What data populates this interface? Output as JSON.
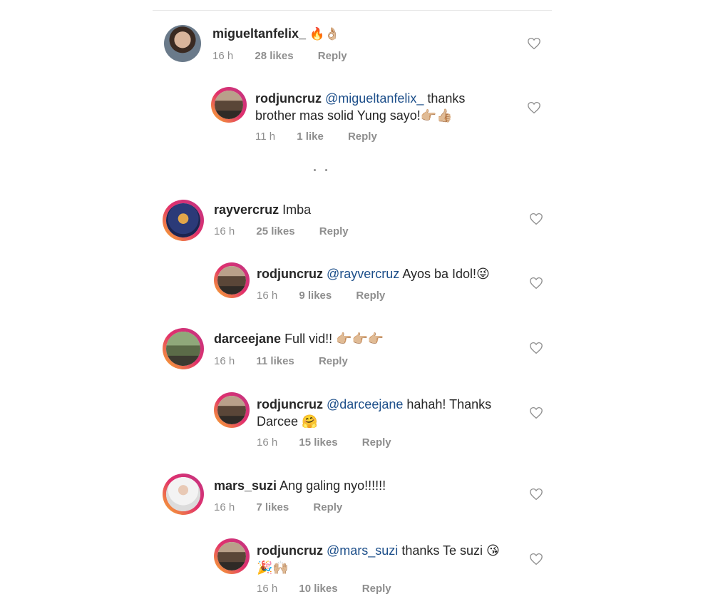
{
  "comments": [
    {
      "username": "migueltanfelix_",
      "text": "🔥👌🏼",
      "time": "16 h",
      "likes": "28 likes",
      "reply": "Reply"
    },
    {
      "username": "rodjuncruz",
      "mention": "@migueltanfelix_",
      "text": " thanks brother mas solid Yung sayo!👉🏼👍🏼",
      "time": "11 h",
      "likes": "1 like",
      "reply": "Reply"
    },
    {
      "username": "rayvercruz",
      "text": " Imba",
      "time": "16 h",
      "likes": "25 likes",
      "reply": "Reply"
    },
    {
      "username": "rodjuncruz",
      "mention": "@rayvercruz",
      "text": " Ayos ba Idol!😜",
      "time": "16 h",
      "likes": "9 likes",
      "reply": "Reply"
    },
    {
      "username": "darceejane",
      "text": " Full vid!! 👉🏼👉🏼👉🏼",
      "time": "16 h",
      "likes": "11 likes",
      "reply": "Reply"
    },
    {
      "username": "rodjuncruz",
      "mention": "@darceejane",
      "text": " hahah! Thanks Darcee 🤗",
      "time": "16 h",
      "likes": "15 likes",
      "reply": "Reply"
    },
    {
      "username": "mars_suzi",
      "text": " Ang galing nyo!!!!!!",
      "time": "16 h",
      "likes": "7 likes",
      "reply": "Reply"
    },
    {
      "username": "rodjuncruz",
      "mention": "@mars_suzi",
      "text": " thanks Te suzi 😘🎉🙌🏼",
      "time": "16 h",
      "likes": "10 likes",
      "reply": "Reply"
    }
  ],
  "icons": {
    "like": "heart-outline-icon",
    "more": "more-replies-dots-icon"
  },
  "colors": {
    "mention": "#1d4f8a",
    "meta": "#8e8e8e",
    "ring_start": "#f9b52b",
    "ring_end": "#c13584"
  }
}
